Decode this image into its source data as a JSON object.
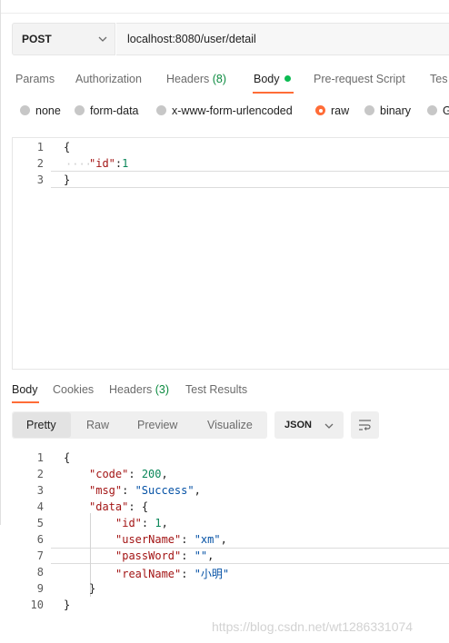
{
  "request": {
    "method": "POST",
    "url": "localhost:8080/user/detail"
  },
  "request_tabs": [
    {
      "label": "Params"
    },
    {
      "label": "Authorization"
    },
    {
      "label": "Headers",
      "count": "(8)"
    },
    {
      "label": "Body"
    },
    {
      "label": "Pre-request Script"
    },
    {
      "label": "Tes"
    }
  ],
  "body_modes": [
    {
      "label": "none",
      "selected": false
    },
    {
      "label": "form-data",
      "selected": false
    },
    {
      "label": "x-www-form-urlencoded",
      "selected": false
    },
    {
      "label": "raw",
      "selected": true
    },
    {
      "label": "binary",
      "selected": false
    },
    {
      "label": "G",
      "selected": false
    }
  ],
  "request_body_lines": [
    {
      "n": "1",
      "text": "{"
    },
    {
      "n": "2",
      "key": "\"id\"",
      "colon": ":",
      "value": "1"
    },
    {
      "n": "3",
      "text": "}"
    }
  ],
  "response_tabs": [
    {
      "label": "Body"
    },
    {
      "label": "Cookies"
    },
    {
      "label": "Headers",
      "count": "(3)"
    },
    {
      "label": "Test Results"
    }
  ],
  "response_views": [
    "Pretty",
    "Raw",
    "Preview",
    "Visualize"
  ],
  "response_format": "JSON",
  "response_lines": [
    {
      "n": "1",
      "text": "{"
    },
    {
      "n": "2",
      "key": "\"code\"",
      "value": "200",
      "vtype": "num",
      "tail": ","
    },
    {
      "n": "3",
      "key": "\"msg\"",
      "value": "\"Success\"",
      "vtype": "str",
      "tail": ","
    },
    {
      "n": "4",
      "key": "\"data\"",
      "value": "{",
      "vtype": "brace",
      "tail": ""
    },
    {
      "n": "5",
      "key": "\"id\"",
      "value": "1",
      "vtype": "num",
      "tail": ","
    },
    {
      "n": "6",
      "key": "\"userName\"",
      "value": "\"xm\"",
      "vtype": "str",
      "tail": ","
    },
    {
      "n": "7",
      "key": "\"passWord\"",
      "value": "\"\"",
      "vtype": "str",
      "tail": ","
    },
    {
      "n": "8",
      "key": "\"realName\"",
      "value": "\"小明\"",
      "vtype": "str",
      "tail": ""
    },
    {
      "n": "9",
      "text": "}"
    },
    {
      "n": "10",
      "text": "}"
    }
  ],
  "watermark": "https://blog.csdn.net/wt1286331074",
  "colors": {
    "accent": "#ff6c37",
    "count_green": "#0b8a3f",
    "json_key": "#a31515",
    "json_number": "#098658",
    "json_string": "#0451a5"
  }
}
